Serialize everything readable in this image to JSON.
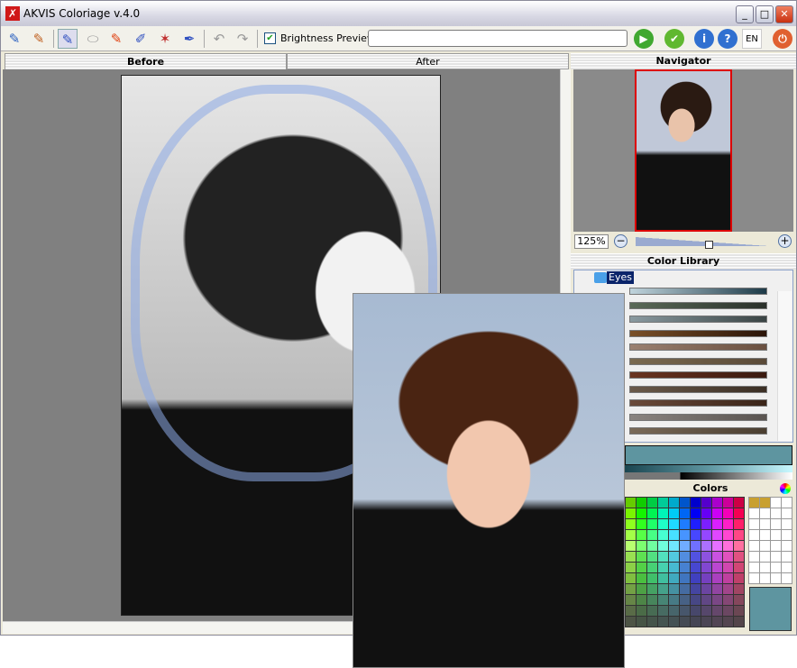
{
  "window": {
    "title": "AKVIS Coloriage v.4.0",
    "controls": [
      "minimize",
      "maximize",
      "close"
    ]
  },
  "toolbar": {
    "tools": [
      "open-icon",
      "save-icon",
      "pencil-icon",
      "eraser-icon",
      "keep-color-pencil-icon",
      "bucket-icon",
      "magic-wand-icon",
      "eyedropper-icon",
      "undo-icon",
      "redo-icon"
    ],
    "brightness_preview_label": "Brightness Preview",
    "brightness_preview_checked": true,
    "progress_field": "",
    "language": "EN"
  },
  "tabs": {
    "before": "Before",
    "after": "After",
    "active": "before"
  },
  "navigator": {
    "title": "Navigator",
    "zoom": "125%",
    "zoom_slider_percent": 55
  },
  "color_library": {
    "title": "Color Library",
    "folder": "Eyes",
    "gradients": [
      [
        "#c0d4dc",
        "#1d3a48"
      ],
      [
        "#5a6a58",
        "#2a302a"
      ],
      [
        "#8a9aa0",
        "#3a4444"
      ],
      [
        "#7a5028",
        "#2a1408"
      ],
      [
        "#9a8070",
        "#6a5040"
      ],
      [
        "#7a6a50",
        "#5a4a38"
      ],
      [
        "#6a3420",
        "#3a1a10"
      ],
      [
        "#6a5a4a",
        "#3a2e24"
      ],
      [
        "#6a4a3a",
        "#3a2418"
      ],
      [
        "#8a8480",
        "#5a5450"
      ],
      [
        "#7a6a58",
        "#4a3e30"
      ]
    ]
  },
  "current_color": "#5e95a0",
  "colors": {
    "title": "Colors",
    "user_swatches": [
      "#c8a030",
      "#c8a030"
    ]
  }
}
